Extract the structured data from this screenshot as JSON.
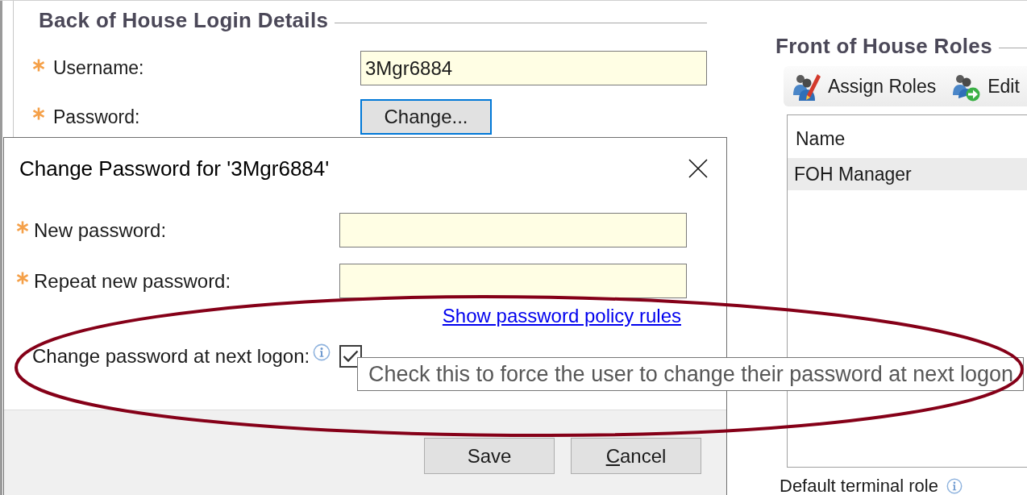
{
  "back_of_house": {
    "title": "Back of House Login Details",
    "fields": [
      {
        "label": "Username:",
        "required": true,
        "kind": "input",
        "value": "3Mgr6884"
      },
      {
        "label": "Password:",
        "required": true,
        "kind": "button",
        "button": "Change...",
        "focused": true
      }
    ]
  },
  "front_of_house": {
    "title": "Front of House Roles",
    "toolbar": [
      {
        "label": "Assign Roles",
        "kind": "assign"
      },
      {
        "label": "Edit",
        "kind": "edit"
      }
    ],
    "table": {
      "columns": [
        "Name"
      ],
      "rows": [
        {
          "cells": [
            "FOH Manager"
          ],
          "selected": true
        }
      ]
    },
    "default_terminal_role": {
      "label": "Default terminal role"
    }
  },
  "dialog": {
    "title": "Change Password for '3Mgr6884'",
    "fields": [
      {
        "label": "New password:",
        "required": true
      },
      {
        "label": "Repeat new password:",
        "required": true
      }
    ],
    "policy_link": "Show password policy rules",
    "force_change": {
      "label": "Change password at next logon:",
      "checked": true,
      "tooltip": "Check this to force the user to change their password at next logon"
    },
    "buttons": [
      {
        "label": "Save",
        "underline_first": false
      },
      {
        "label": "Cancel",
        "underline_first": true
      }
    ]
  }
}
